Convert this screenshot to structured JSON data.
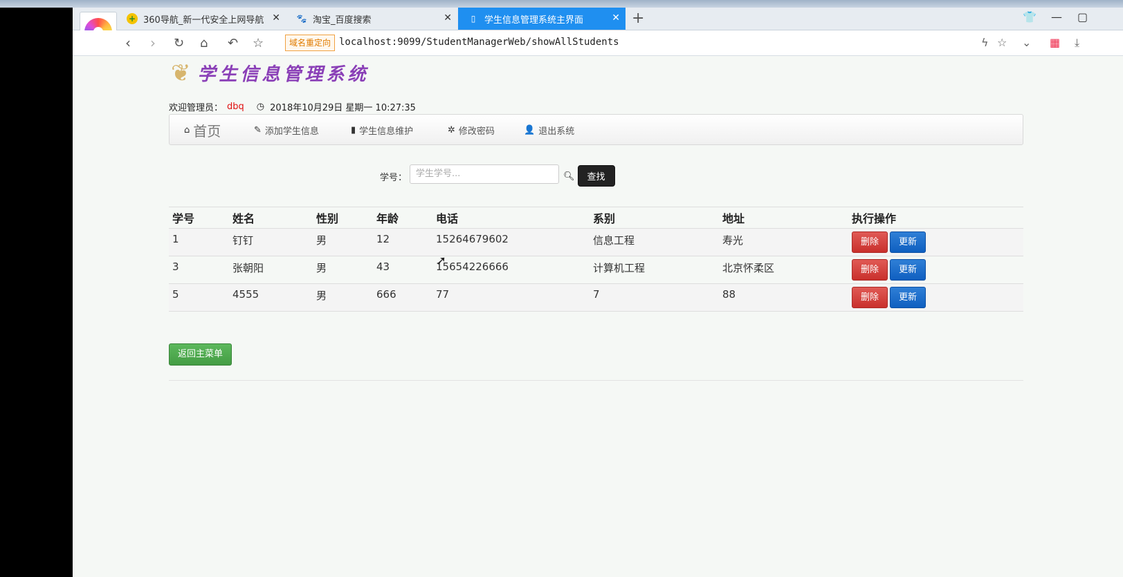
{
  "browser": {
    "tabs": [
      {
        "label": "360导航_新一代安全上网导航",
        "icon": "360-icon"
      },
      {
        "label": "淘宝_百度搜索",
        "icon": "baidu-paw-icon"
      },
      {
        "label": "学生信息管理系统主界面",
        "icon": "page-icon",
        "active": true
      }
    ],
    "redirect_badge": "域名重定向",
    "url": "localhost:9099/StudentManagerWeb/showAllStudents"
  },
  "header": {
    "title": "学生信息管理系统",
    "welcome_label": "欢迎管理员：",
    "admin_name": "dbq",
    "datetime": "2018年10月29日 星期一 10:27:35"
  },
  "nav": {
    "home": "首页",
    "add": "添加学生信息",
    "maintain": "学生信息维护",
    "password": "修改密码",
    "logout": "退出系统"
  },
  "search": {
    "label": "学号：",
    "placeholder": "学生学号...",
    "button": "查找"
  },
  "table": {
    "headers": [
      "学号",
      "姓名",
      "性别",
      "年龄",
      "电话",
      "系别",
      "地址",
      "执行操作"
    ],
    "rows": [
      [
        "1",
        "钉钉",
        "男",
        "12",
        "15264679602",
        "信息工程",
        "寿光"
      ],
      [
        "3",
        "张朝阳",
        "男",
        "43",
        "15654226666",
        "计算机工程",
        "北京怀柔区"
      ],
      [
        "5",
        "4555",
        "男",
        "666",
        "77",
        "7",
        "88"
      ]
    ],
    "delete_label": "删除",
    "update_label": "更新"
  },
  "back_button": "返回主菜单",
  "colors": {
    "accent_tab": "#1f8ff0",
    "delete": "#d9534f",
    "update": "#0f5fc0",
    "back": "#5cb85c",
    "admin_name": "#e01010",
    "title": "#8a3fb7"
  }
}
